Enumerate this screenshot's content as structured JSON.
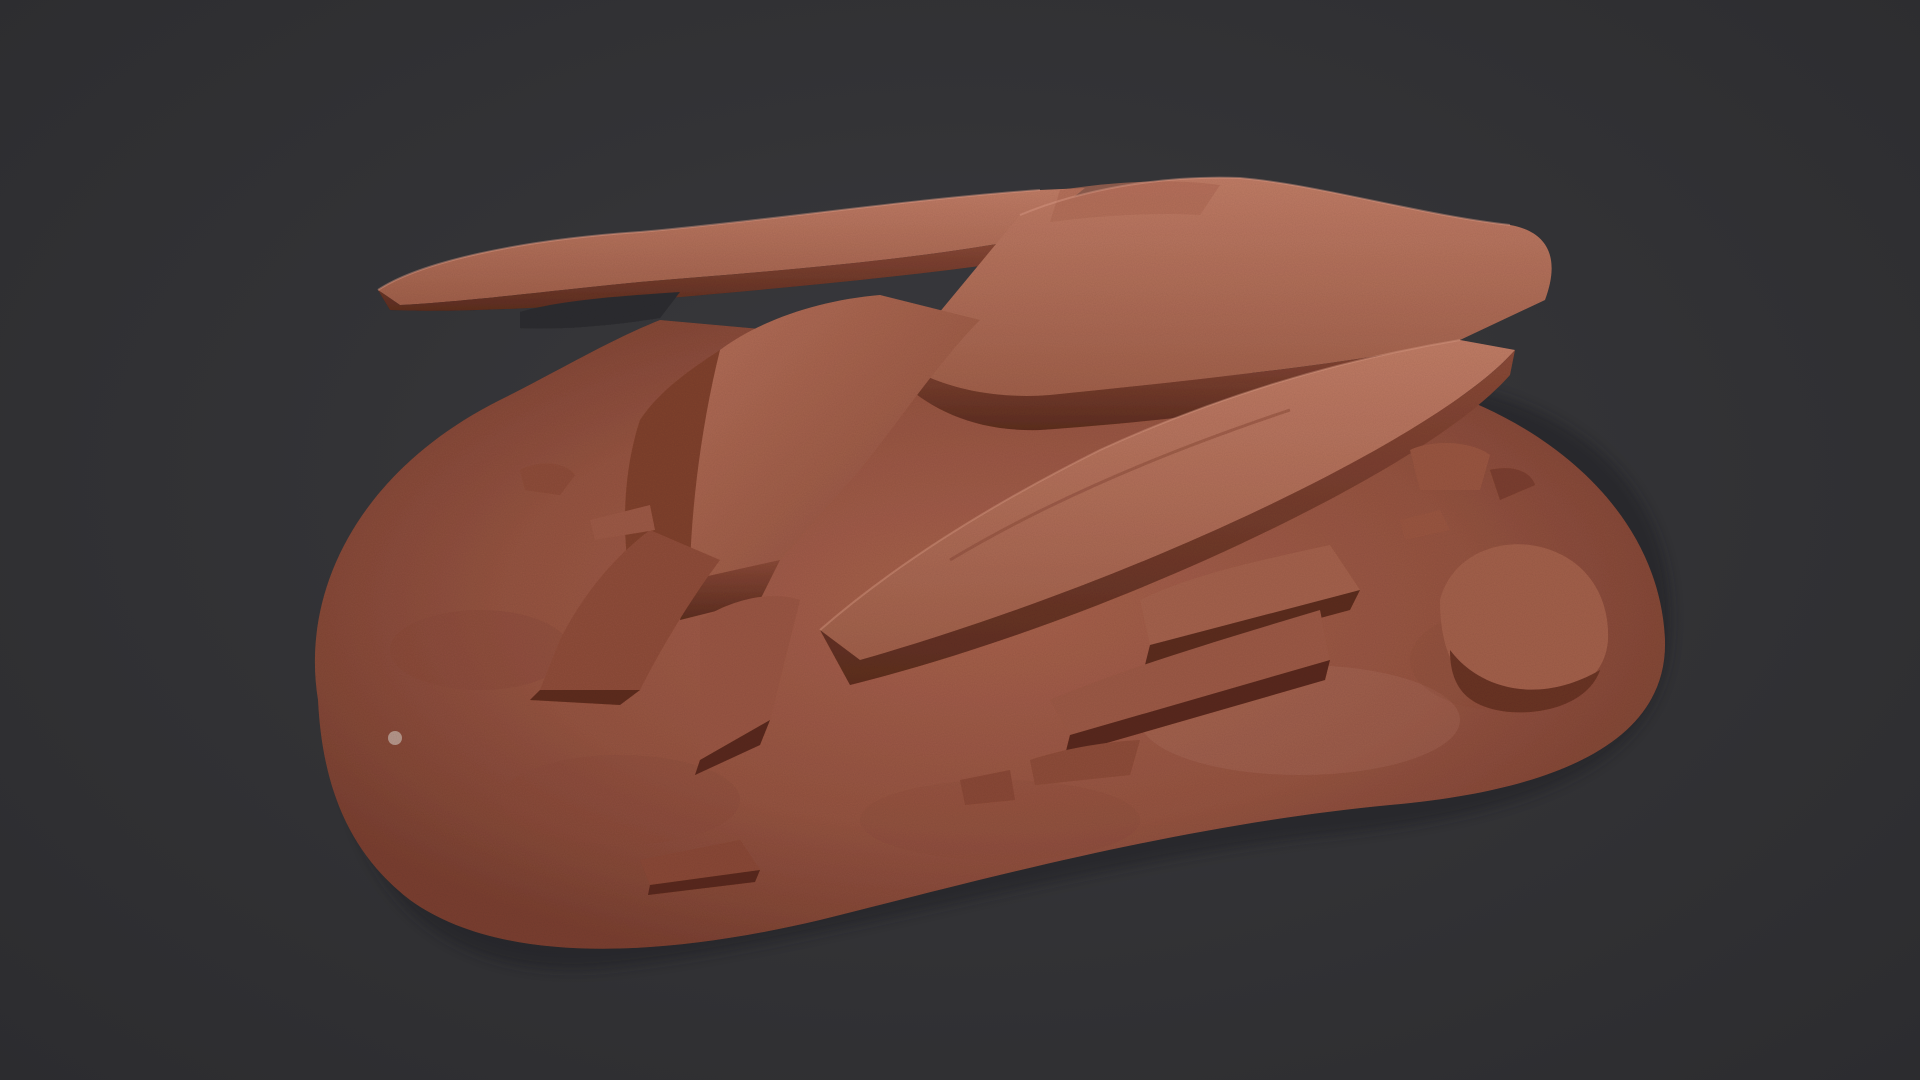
{
  "scene": {
    "subject": "rock-formation-3d-scan",
    "colors": {
      "background": "#303033",
      "ground": "#9a5a48",
      "ground_dark": "#6e3a2c",
      "rock_light": "#b87460",
      "rock_mid": "#9c5a46",
      "rock_dark": "#6a3528",
      "shadow": "#4a241b"
    }
  }
}
